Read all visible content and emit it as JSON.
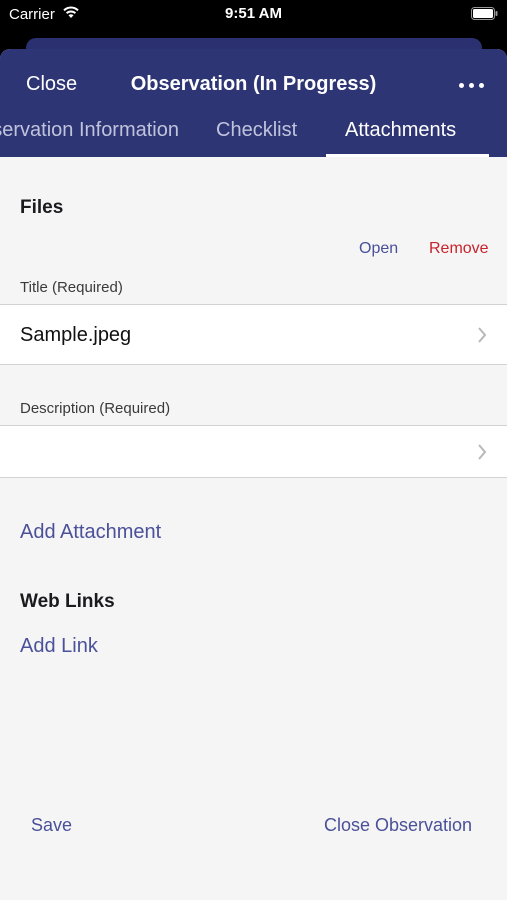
{
  "status_bar": {
    "carrier": "Carrier",
    "time": "9:51 AM"
  },
  "nav": {
    "close_label": "Close",
    "title": "Observation (In Progress)",
    "tabs": [
      {
        "label": "Observation Information"
      },
      {
        "label": "Checklist"
      },
      {
        "label": "Attachments",
        "active": true
      }
    ]
  },
  "files": {
    "heading": "Files",
    "open_label": "Open",
    "remove_label": "Remove",
    "title_label": "Title (Required)",
    "title_value": "Sample.jpeg",
    "description_label": "Description (Required)",
    "description_value": "",
    "add_attachment_label": "Add Attachment"
  },
  "web_links": {
    "heading": "Web Links",
    "add_link_label": "Add Link"
  },
  "footer": {
    "save_label": "Save",
    "close_observation_label": "Close Observation"
  },
  "colors": {
    "nav_background": "#2e3574",
    "link": "#4a5099",
    "destructive": "#c8232c",
    "sheet_background": "#f5f5f5"
  },
  "icons": [
    "wifi-icon",
    "battery-icon",
    "more-icon",
    "chevron-right-icon"
  ]
}
